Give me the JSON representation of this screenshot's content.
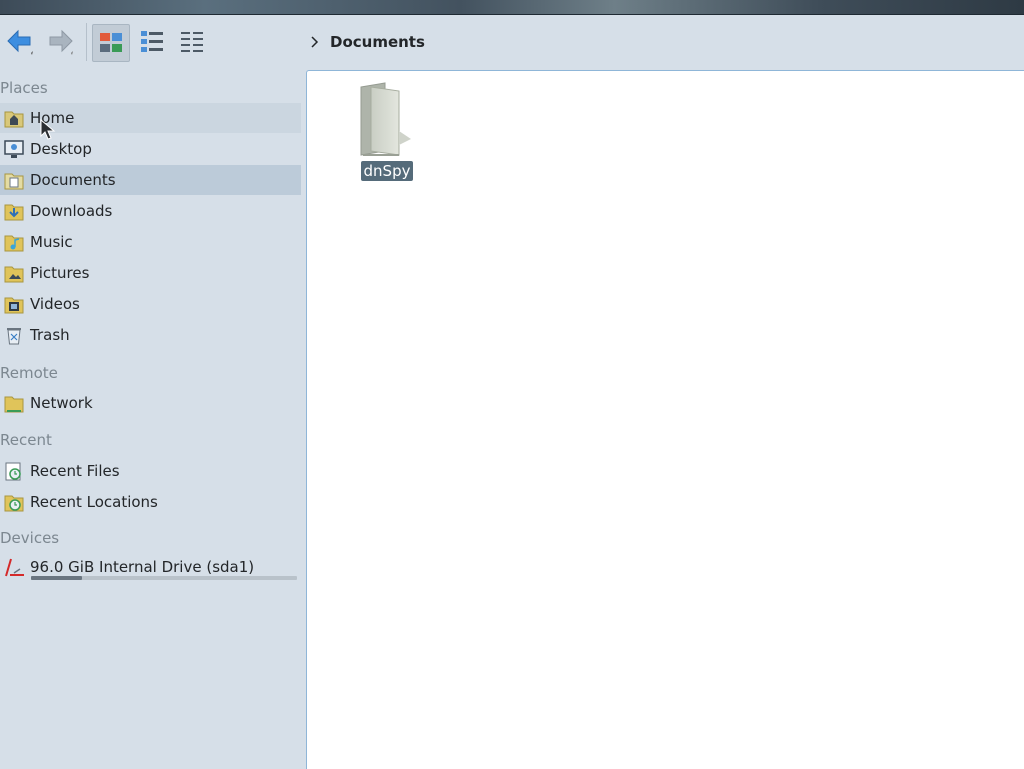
{
  "toolbar": {
    "back_icon": "arrow-left-icon",
    "forward_icon": "arrow-right-icon",
    "view_modes": [
      "icons-view-icon",
      "details-view-icon",
      "compact-view-icon"
    ]
  },
  "breadcrumb": {
    "separator_icon": "chevron-right-icon",
    "current": "Documents"
  },
  "sidebar": {
    "places_title": "Places",
    "places": [
      {
        "label": "Home",
        "icon": "home-folder-icon"
      },
      {
        "label": "Desktop",
        "icon": "desktop-icon"
      },
      {
        "label": "Documents",
        "icon": "documents-folder-icon"
      },
      {
        "label": "Downloads",
        "icon": "downloads-folder-icon"
      },
      {
        "label": "Music",
        "icon": "music-folder-icon"
      },
      {
        "label": "Pictures",
        "icon": "pictures-folder-icon"
      },
      {
        "label": "Videos",
        "icon": "videos-folder-icon"
      },
      {
        "label": "Trash",
        "icon": "trash-icon"
      }
    ],
    "remote_title": "Remote",
    "remote": [
      {
        "label": "Network",
        "icon": "network-folder-icon"
      }
    ],
    "recent_title": "Recent",
    "recent": [
      {
        "label": "Recent Files",
        "icon": "recent-files-icon"
      },
      {
        "label": "Recent Locations",
        "icon": "recent-locations-icon"
      }
    ],
    "devices_title": "Devices",
    "devices": [
      {
        "label": "96.0 GiB Internal Drive (sda1)",
        "icon": "drive-icon",
        "usage_fraction": 0.19
      }
    ]
  },
  "content": {
    "files": [
      {
        "name": "dnSpy",
        "icon": "folder-icon",
        "selected": true
      }
    ]
  },
  "colors": {
    "sidebar_bg": "#d6dfe8",
    "selected_bg": "#bccbd9",
    "file_label_bg": "#556b7a",
    "content_border": "#8fb6d8"
  }
}
